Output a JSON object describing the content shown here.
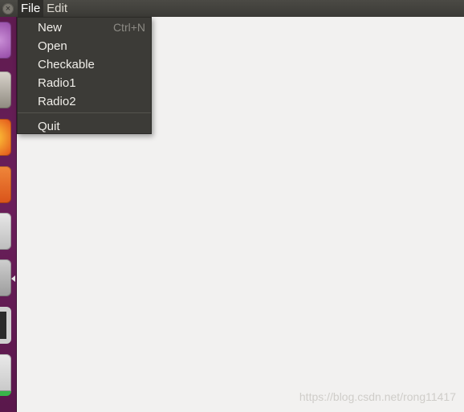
{
  "menubar": {
    "close_symbol": "×",
    "menus": [
      {
        "label": "File"
      },
      {
        "label": "Edit"
      }
    ]
  },
  "file_menu": {
    "items": [
      {
        "label": "New",
        "shortcut": "Ctrl+N"
      },
      {
        "label": "Open"
      },
      {
        "label": "Checkable"
      },
      {
        "label": "Radio1"
      },
      {
        "label": "Radio2"
      },
      {
        "label": "Quit"
      }
    ]
  },
  "launcher": {
    "icons": [
      "app-icon-purple",
      "files-icon",
      "firefox-icon",
      "orange-app-icon",
      "tools-icon",
      "settings-icon",
      "terminal-icon",
      "green-app-icon"
    ]
  },
  "watermark": {
    "text": "https://blog.csdn.net/rong11417"
  },
  "colors": {
    "launcher_bg": "#6a1f5a",
    "panel_bg": "#3c3b37",
    "canvas_bg": "#f2f1f0"
  }
}
